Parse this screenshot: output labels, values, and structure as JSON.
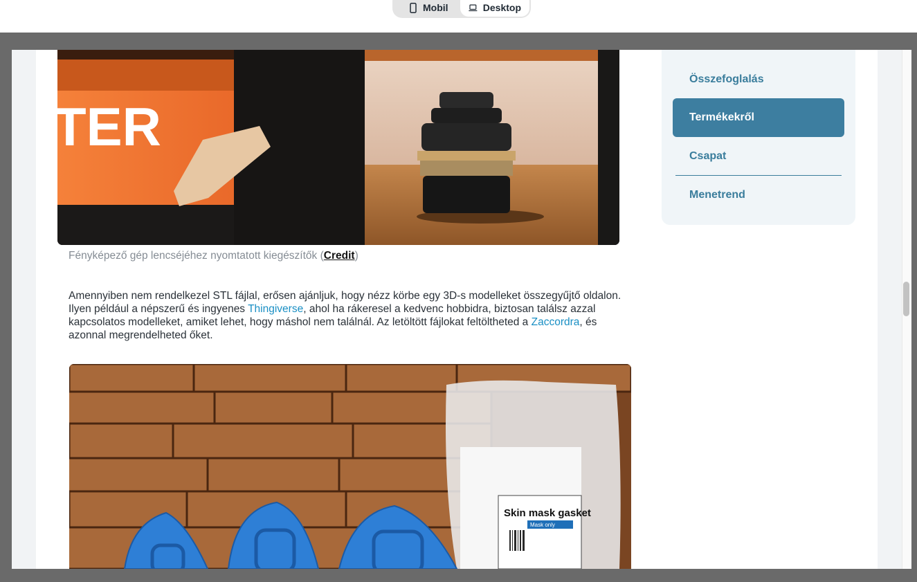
{
  "toggle": {
    "mobil_label": "Mobil",
    "desktop_label": "Desktop"
  },
  "article": {
    "caption_text": "Fényképező gép lencséjéhez nyomtatott kiegészítők (",
    "caption_link": "Credit",
    "caption_end": ")",
    "para_1": "Amennyiben nem rendelkezel STL fájlal, erősen ajánljuk, hogy nézz körbe egy 3D-s modelleket összegyűjtő oldalon. Ilyen például a népszerű és ingyenes ",
    "link_thingiverse": "Thingiverse",
    "para_2": ", ahol ha rákeresel a kedvenc hobbidra, biztosan találsz azzal kapcsolatos modelleket, amiket lehet, hogy máshol nem találnál. Az letöltött fájlokat feltöltheted a ",
    "link_zaccordra": "Zaccordra",
    "para_3": ", és azonnal megrendelheted őket.",
    "image1_text": "TER",
    "image2_label_title": "Skin mask gasket",
    "image2_label_small": "Mask only"
  },
  "toc": {
    "items": [
      {
        "label": "Összefoglalás",
        "active": false
      },
      {
        "label": "Termékekről",
        "active": true
      },
      {
        "label": "Csapat",
        "active": false
      },
      {
        "label": "Menetrend",
        "active": false
      }
    ]
  },
  "colors": {
    "accent": "#3d7ea0",
    "link": "#1a8fc4",
    "toc_bg": "#f0f5f8"
  }
}
